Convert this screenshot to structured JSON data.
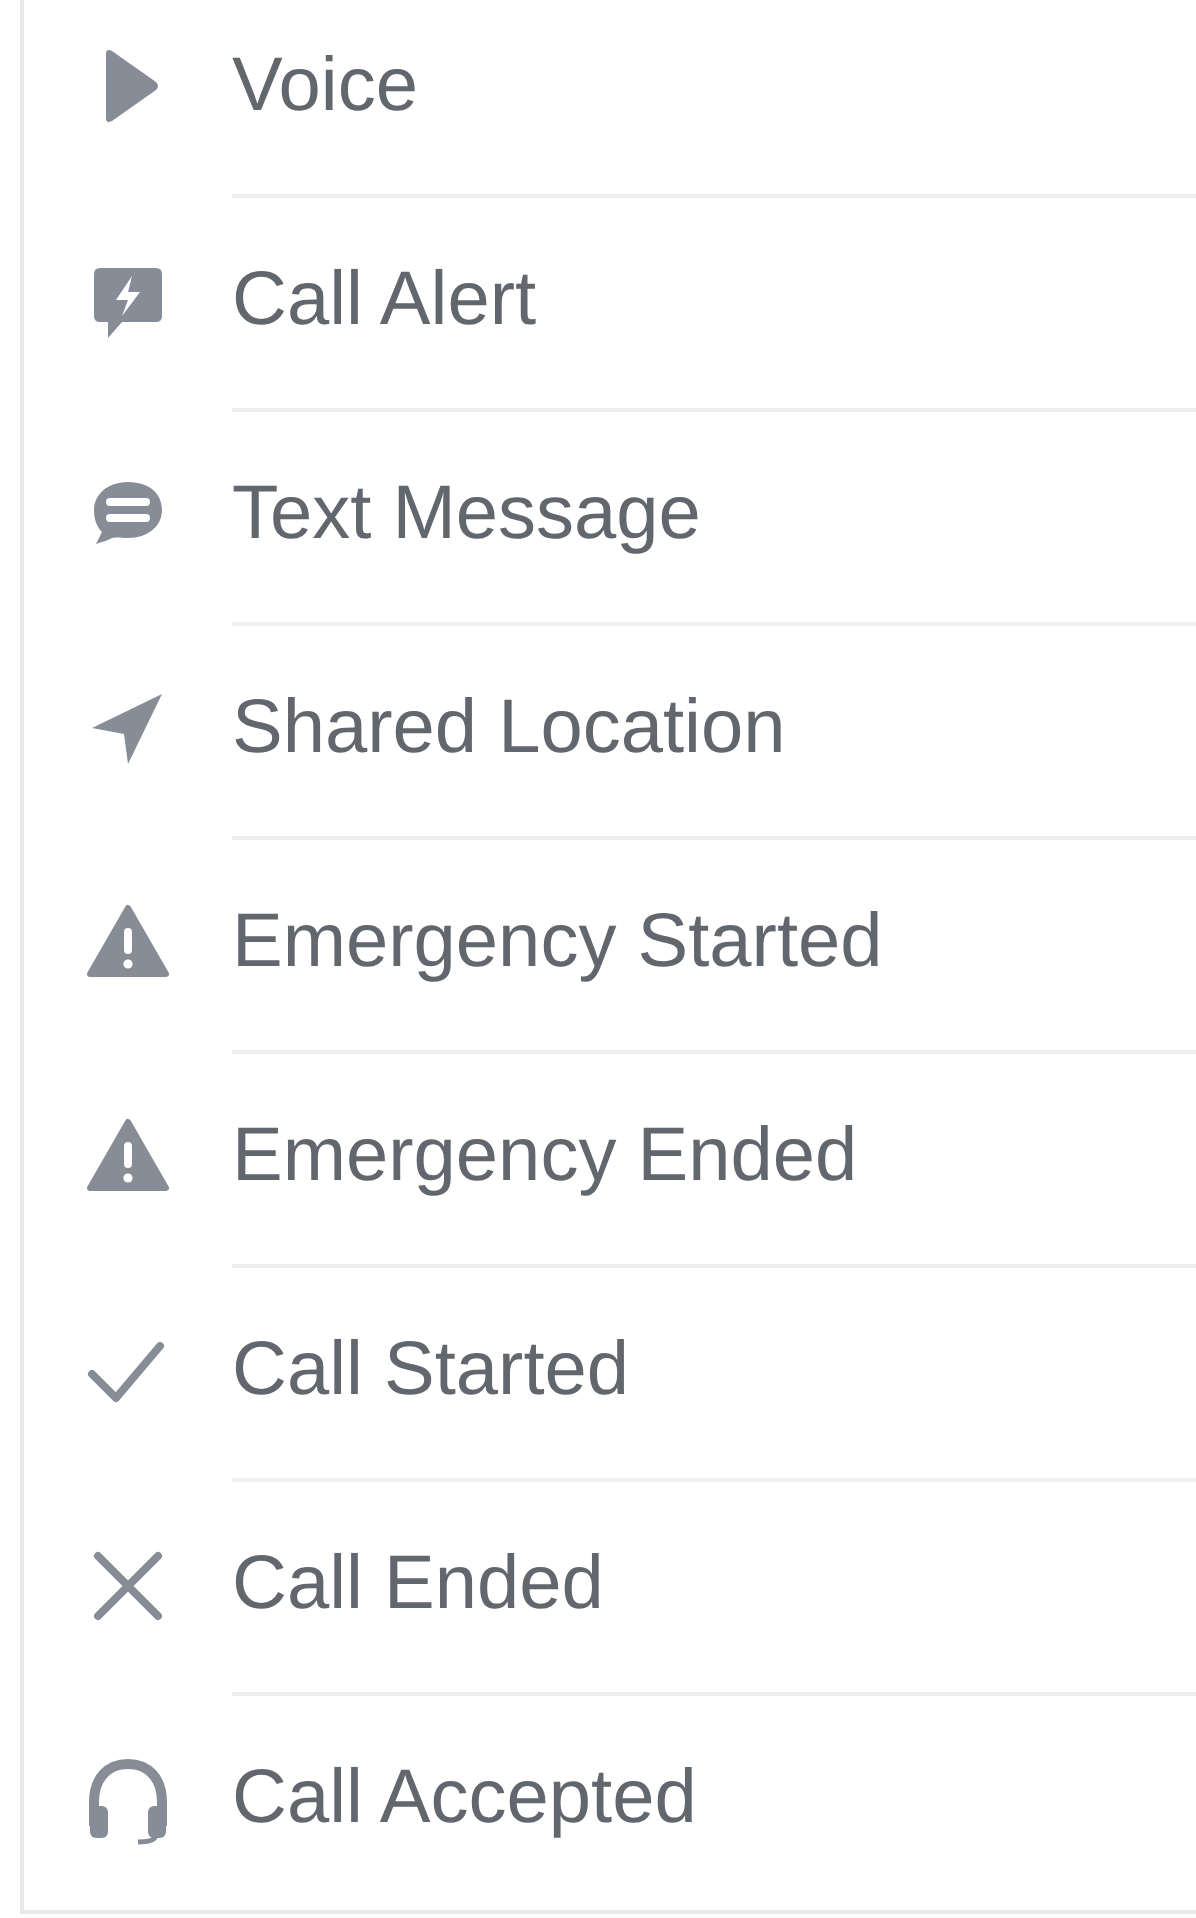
{
  "menu": {
    "items": [
      {
        "label": "Voice"
      },
      {
        "label": "Call Alert"
      },
      {
        "label": "Text Message"
      },
      {
        "label": "Shared Location"
      },
      {
        "label": "Emergency Started"
      },
      {
        "label": "Emergency Ended"
      },
      {
        "label": "Call Started"
      },
      {
        "label": "Call Ended"
      },
      {
        "label": "Call Accepted"
      }
    ]
  }
}
